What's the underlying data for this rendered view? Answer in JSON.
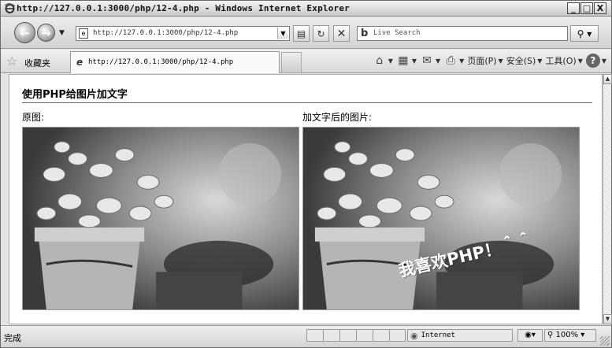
{
  "window": {
    "title": "http://127.0.0.1:3000/php/12-4.php - Windows Internet Explorer",
    "minimize": "_",
    "maximize": "□",
    "close": "X"
  },
  "address_bar": {
    "url": "http://127.0.0.1:3000/php/12-4.php",
    "search_placeholder": "Live Search"
  },
  "favorites": {
    "label": "收藏夹",
    "tab_title": "http://127.0.0.1:3000/php/12-4.php"
  },
  "command_bar": {
    "page_menu": "页面(P)",
    "safety_menu": "安全(S)",
    "tools_menu": "工具(O)"
  },
  "page": {
    "heading": "使用PHP给图片加文字",
    "original_caption": "原图:",
    "result_caption": "加文字后的图片:",
    "watermark_text": "我喜欢PHP！＾＾"
  },
  "status_bar": {
    "status": "完成",
    "zone": "Internet",
    "zoom": "100%"
  }
}
